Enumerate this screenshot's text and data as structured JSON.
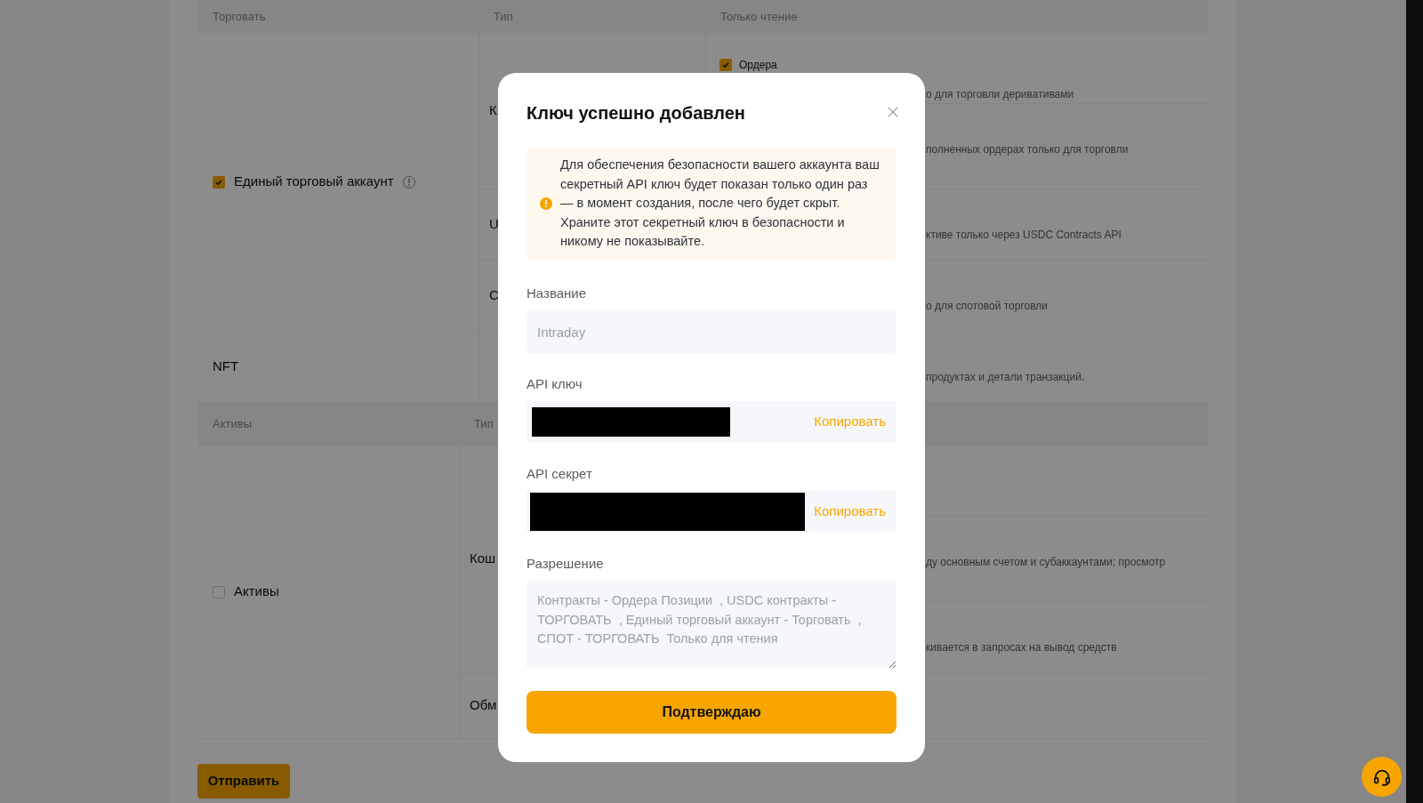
{
  "trade_table": {
    "columns": [
      "Торговать",
      "Тип",
      "Только чтение"
    ],
    "groups": [
      {
        "kind": "checkbox",
        "label": "Единый торговый аккаунт",
        "checked": true,
        "info_icon": true,
        "types": [
          {
            "type": "К",
            "permissions": [
              {
                "checkbox": {
                  "label": "Ордера",
                  "checked": true
                },
                "description": "о для торговли деривативами"
              },
              {
                "description": "полненных ордерах только для торговли"
              }
            ]
          },
          {
            "type": "U",
            "permissions": [
              {
                "description": "ктиве только через USDC Contracts API"
              }
            ]
          },
          {
            "type": "С",
            "permissions": [
              {
                "description": "о для спотовой торговли"
              }
            ]
          }
        ]
      },
      {
        "kind": "plain",
        "label": "NFT",
        "types": [
          {
            "permissions": [
              {
                "description": "продуктах и детали транзакций."
              }
            ]
          }
        ]
      }
    ]
  },
  "assets_table": {
    "columns": [
      "Активы",
      "Тип"
    ],
    "groups": [
      {
        "kind": "checkbox",
        "label": "Активы",
        "checked": false,
        "types": [
          {
            "type": "Кош",
            "permissions": [
              {
                "description": "ду основным счетом и субаккаунтами; просмотр"
              },
              {
                "description": "кивается в запросах на вывод средств"
              }
            ]
          },
          {
            "type": "Обм"
          }
        ]
      }
    ]
  },
  "submit_button": "Отправить",
  "dialog": {
    "title": "Ключ успешно добавлен",
    "warning": "Для обеспечения безопасности вашего аккаунта ваш секретный API ключ будет показан только один раз — в момент создания, после чего будет скрыт. Храните этот секретный ключ в безопасности и никому не показывайте.",
    "fields": [
      {
        "kind": "input",
        "label": "Название",
        "value": "Intraday",
        "disabled": true
      },
      {
        "kind": "secret",
        "label": "API ключ",
        "redacted": true,
        "action": "Копировать"
      },
      {
        "kind": "secret",
        "label": "API секрет",
        "redacted": true,
        "action": "Копировать"
      },
      {
        "kind": "textarea",
        "label": "Разрешение",
        "value": "Контракты - Ордера Позиции  , USDC контракты - ТОРГОВАТЬ  , Единый торговый аккаунт - Торговать  , СПОТ - ТОРГОВАТЬ  Только для чтения",
        "disabled": true
      }
    ],
    "confirm_button": "Подтверждаю"
  }
}
